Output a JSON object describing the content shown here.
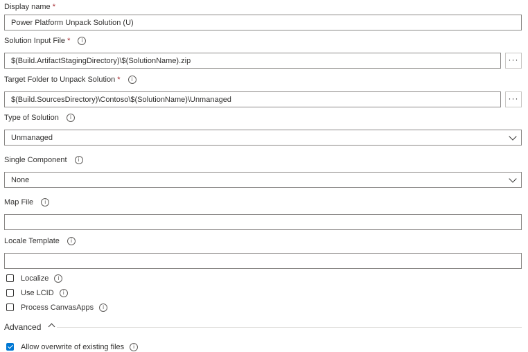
{
  "display_name": {
    "label": "Display name",
    "required": "*",
    "value": "Power Platform Unpack Solution (U)"
  },
  "solution_input_file": {
    "label": "Solution Input File",
    "required": "*",
    "value": "$(Build.ArtifactStagingDirectory)\\$(SolutionName).zip",
    "browse_label": "···"
  },
  "target_folder": {
    "label": "Target Folder to Unpack Solution",
    "required": "*",
    "value": "$(Build.SourcesDirectory)\\Contoso\\$(SolutionName)\\Unmanaged",
    "browse_label": "···"
  },
  "type_of_solution": {
    "label": "Type of Solution",
    "value": "Unmanaged"
  },
  "single_component": {
    "label": "Single Component",
    "value": "None"
  },
  "map_file": {
    "label": "Map File",
    "value": ""
  },
  "locale_template": {
    "label": "Locale Template",
    "value": ""
  },
  "checkboxes": {
    "localize": {
      "label": "Localize",
      "checked": false
    },
    "use_lcid": {
      "label": "Use LCID",
      "checked": false
    },
    "process_canvasapps": {
      "label": "Process CanvasApps",
      "checked": false
    }
  },
  "advanced": {
    "label": "Advanced",
    "expanded": true
  },
  "allow_overwrite": {
    "label": "Allow overwrite of existing files",
    "checked": true
  },
  "info_icon_glyph": "i",
  "accent_color": "#0078d4"
}
